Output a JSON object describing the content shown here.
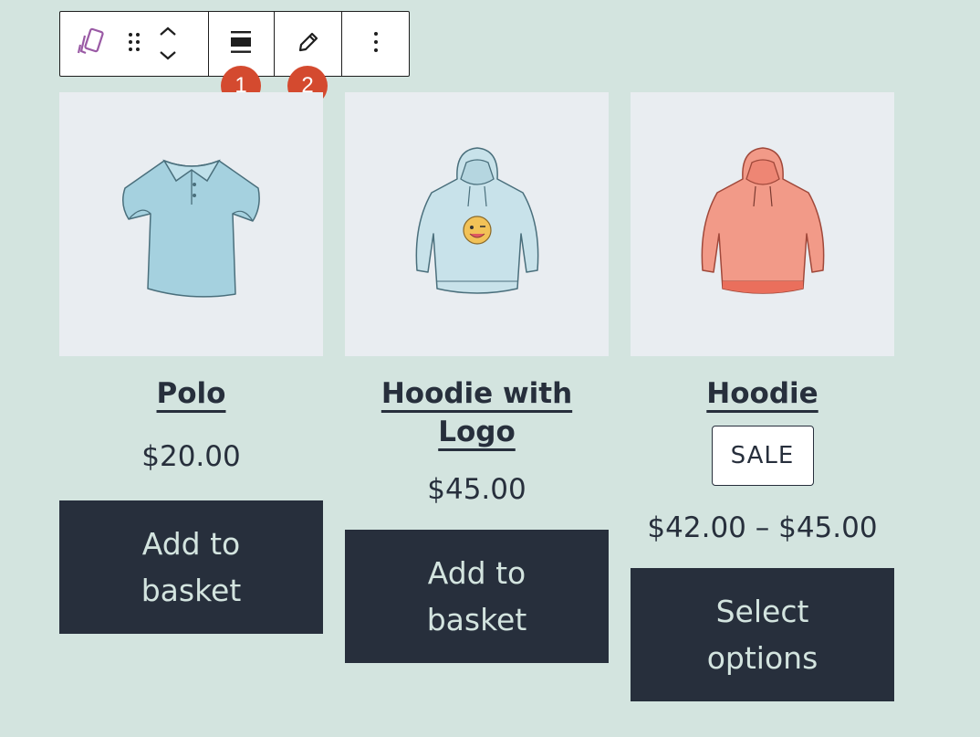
{
  "toolbar": {
    "icons": [
      "block-type-icon",
      "drag-handle-icon",
      "move-up-icon",
      "move-down-icon",
      "align-icon",
      "edit-icon",
      "more-options-icon"
    ]
  },
  "badges": [
    "1",
    "2"
  ],
  "colors": {
    "background": "#d3e4df",
    "button": "#272f3c",
    "button_text": "#d3e4df",
    "badge": "#d44a2f",
    "thumb_bg": "#e9edf1"
  },
  "products": [
    {
      "title": "Polo",
      "price": "$20.00",
      "button": "Add to basket",
      "image": "polo-shirt-image"
    },
    {
      "title": "Hoodie with Logo",
      "price": "$45.00",
      "button": "Add to basket",
      "image": "hoodie-with-logo-image"
    },
    {
      "title": "Hoodie",
      "sale": "SALE",
      "price": "$42.00 – $45.00",
      "button": "Select options",
      "image": "pink-hoodie-image"
    }
  ]
}
